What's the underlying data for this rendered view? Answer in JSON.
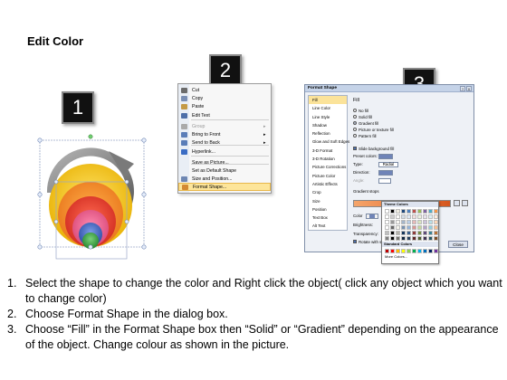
{
  "title": "Edit Color",
  "steps": [
    "1",
    "2",
    "3"
  ],
  "context_menu": {
    "items": [
      {
        "label": "Cut",
        "icon": "scissors-icon",
        "color": "#6b6b6b"
      },
      {
        "label": "Copy",
        "icon": "copy-icon",
        "color": "#7a8fb5"
      },
      {
        "label": "Paste",
        "icon": "paste-icon",
        "color": "#c49a46"
      },
      {
        "label": "Edit Text",
        "icon": "edit-text-icon",
        "color": "#4e6fa8"
      },
      {
        "label": "Group",
        "icon": "group-icon",
        "color": "#aaaaaa",
        "disabled": true,
        "submenu": true
      },
      {
        "label": "Bring to Front",
        "icon": "bring-front-icon",
        "color": "#5a7db8",
        "submenu": true
      },
      {
        "label": "Send to Back",
        "icon": "send-back-icon",
        "color": "#5a7db8",
        "submenu": true
      },
      {
        "label": "Hyperlink...",
        "icon": "hyperlink-icon",
        "color": "#3a6cc4"
      },
      {
        "label": "Save as Picture...",
        "icon": "",
        "color": ""
      },
      {
        "label": "Set as Default Shape",
        "icon": "",
        "color": ""
      },
      {
        "label": "Size and Position...",
        "icon": "size-position-icon",
        "color": "#6d86b3"
      },
      {
        "label": "Format Shape...",
        "icon": "format-shape-icon",
        "color": "#d38a33",
        "highlighted": true
      }
    ]
  },
  "dialog": {
    "title": "Format Shape",
    "window_buttons": [
      "?",
      "X"
    ],
    "nav": [
      "Fill",
      "Line Color",
      "Line Style",
      "Shadow",
      "Reflection",
      "Glow and Soft Edges",
      "3-D Format",
      "3-D Rotation",
      "Picture Corrections",
      "Picture Color",
      "Artistic Effects",
      "Crop",
      "Size",
      "Position",
      "Text Box",
      "Alt Text"
    ],
    "selected_nav": "Fill",
    "fill_header": "Fill",
    "fill_options": [
      {
        "label": "No fill",
        "selected": false
      },
      {
        "label": "Solid fill",
        "selected": false
      },
      {
        "label": "Gradient fill",
        "selected": true
      },
      {
        "label": "Picture or texture fill",
        "selected": false
      },
      {
        "label": "Pattern fill",
        "selected": false
      }
    ],
    "slide_background": {
      "label": "Slide background fill",
      "checked": true
    },
    "preset_colors": "Preset colors:",
    "type": {
      "label": "Type:",
      "value": "Radial"
    },
    "direction": "Direction:",
    "angle": "Angle:",
    "gradient_stops": "Gradient stops",
    "color_label": "Color",
    "position": {
      "label": "Position:",
      "value": "0%"
    },
    "brightness": "Brightness:",
    "transparency": "Transparency:",
    "rotate": {
      "label": "Rotate with shape",
      "checked": true
    },
    "close_button": "Close",
    "palette": {
      "theme_header": "Theme Colors",
      "standard_header": "Standard Colors",
      "more": "More Colors...",
      "theme_top": [
        "#ffffff",
        "#000000",
        "#eeece1",
        "#1f497d",
        "#4f81bd",
        "#c0504d",
        "#9bbb59",
        "#8064a2",
        "#4bacc6",
        "#f79646"
      ],
      "standard": [
        "#c00000",
        "#ff0000",
        "#ffc000",
        "#ffff00",
        "#92d050",
        "#00b050",
        "#00b0f0",
        "#0070c0",
        "#002060",
        "#7030a0"
      ]
    }
  },
  "instructions": [
    {
      "num": "1.",
      "text": "Select the shape to change the color and Right click the object( click any object which you want to change color)"
    },
    {
      "num": "2.",
      "text": "Choose Format Shape in the dialog box."
    },
    {
      "num": "3.",
      "text": "Choose “Fill” in the Format Shape box then “Solid” or “Gradient” depending on the appearance of the object. Change colour as shown in the picture."
    }
  ],
  "colors": {
    "shape_yellow": "#f2c200",
    "shape_orange": "#f58a1f",
    "shape_red": "#e03a2a",
    "shape_pink": "#e8608e",
    "shape_blue": "#3f63c0",
    "shape_green": "#3aa04a",
    "arrow_gray": "#8a8a8a",
    "highlight": "#fde59a"
  }
}
